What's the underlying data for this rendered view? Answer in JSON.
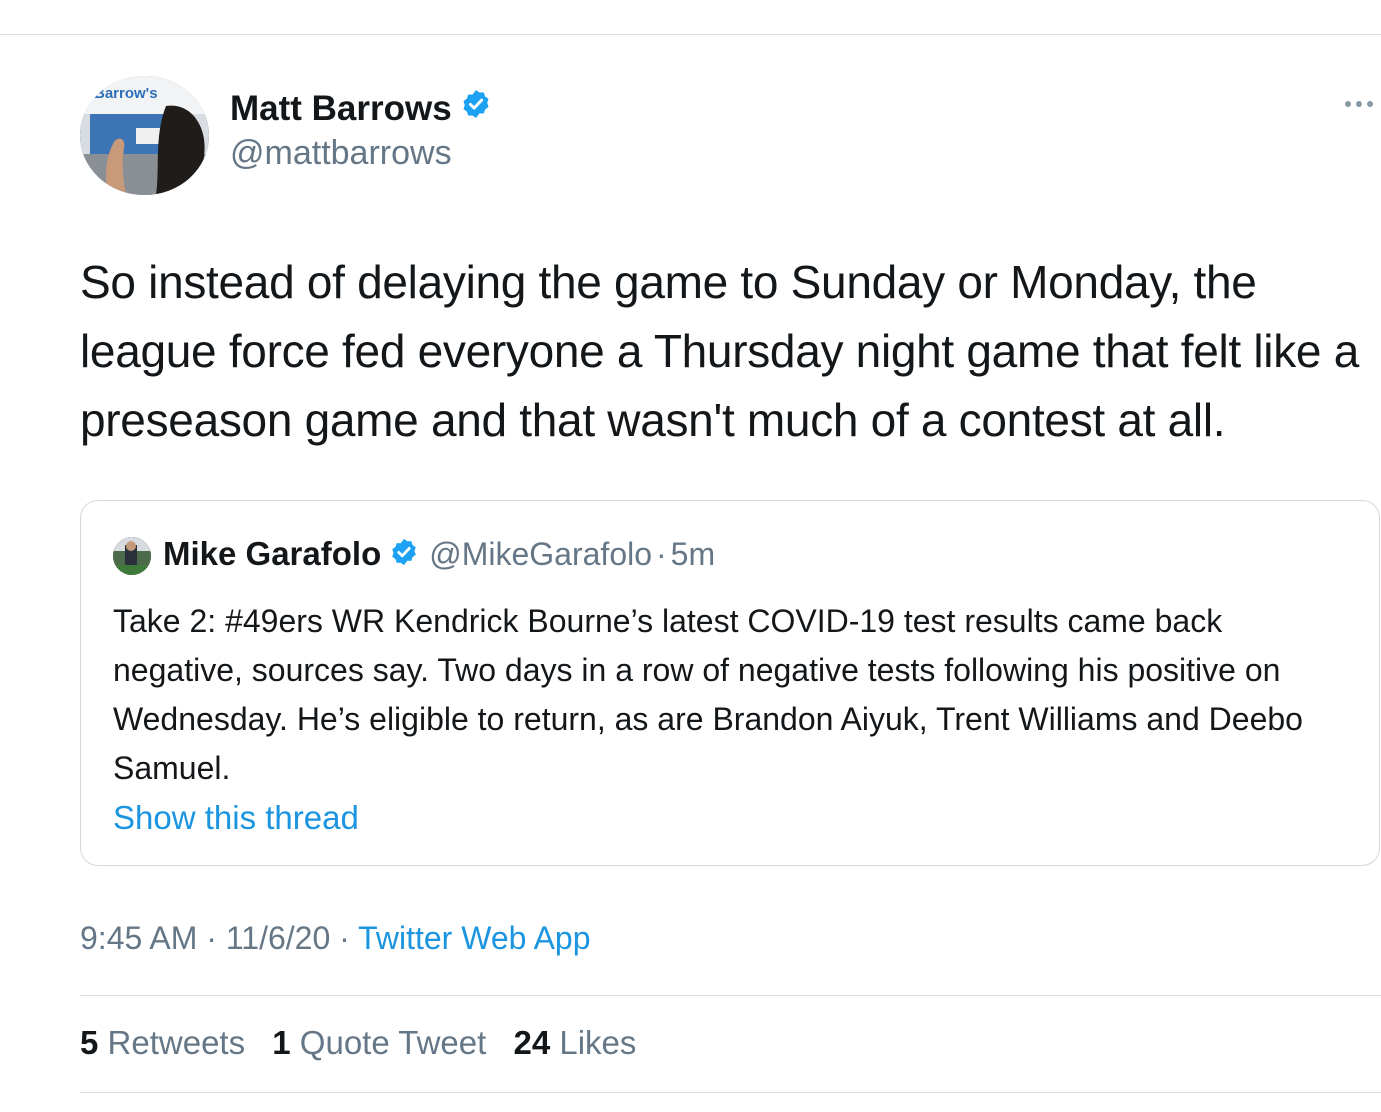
{
  "tweet": {
    "author": {
      "name": "Matt Barrows",
      "handle": "@mattbarrows",
      "avatar_text": "Barrow's"
    },
    "text": "So instead of delaying the game to Sunday or Monday, the league force fed everyone a Thursday night game that felt like a preseason game and that wasn't much of a contest at all.",
    "more_icon": "more-horizontal-icon",
    "quoted": {
      "name": "Mike Garafolo",
      "handle": "@MikeGarafolo",
      "separator": "·",
      "time": "5m",
      "text": "Take 2: #49ers WR Kendrick Bourne’s latest COVID-19 test results came back negative, sources say. Two days in a row of negative tests following his positive on Wednesday. He’s eligible to return, as are Brandon Aiyuk, Trent Williams and Deebo Samuel.",
      "thread_link": "Show this thread"
    },
    "meta": {
      "time": "9:45 AM",
      "sep1": " · ",
      "date": "11/6/20",
      "sep2": " · ",
      "source": "Twitter Web App"
    },
    "stats": {
      "retweets_count": "5",
      "retweets_label": "Retweets",
      "quotes_count": "1",
      "quotes_label": "Quote Tweet",
      "likes_count": "24",
      "likes_label": "Likes"
    }
  },
  "colors": {
    "accent": "#1b95e0",
    "verified": "#1da1f2",
    "secondary_text": "#657786",
    "primary_text": "#14171a",
    "border": "#cfd9de"
  }
}
